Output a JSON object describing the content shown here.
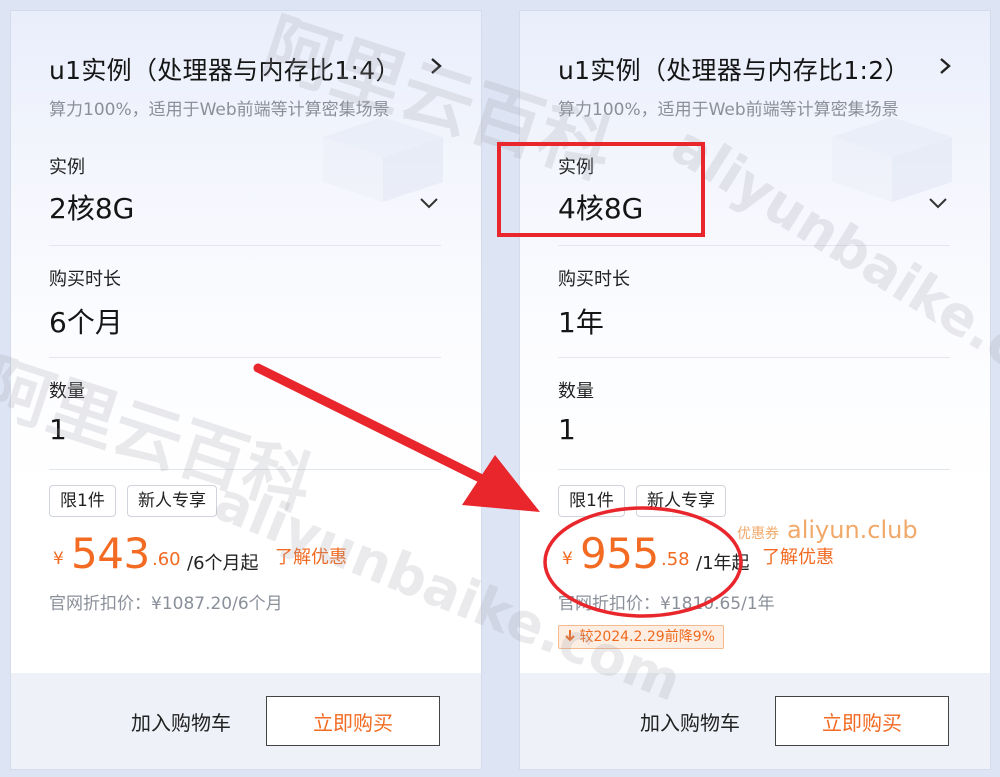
{
  "cards": [
    {
      "title": "u1实例（处理器与内存比1:4）",
      "subtitle": "算力100%，适用于Web前端等计算密集场景",
      "instance_label": "实例",
      "instance_value": "2核8G",
      "duration_label": "购买时长",
      "duration_value": "6个月",
      "quantity_label": "数量",
      "quantity_value": "1",
      "tags": [
        "限1件",
        "新人专享"
      ],
      "price_currency": "¥",
      "price_integer": "543",
      "price_decimal": ".60",
      "price_unit": "/6个月起",
      "learn_more": "了解优惠",
      "official_price": "官网折扣价：¥1087.20/6个月",
      "add_to_cart": "加入购物车",
      "buy_now": "立即购买"
    },
    {
      "title": "u1实例（处理器与内存比1:2）",
      "subtitle": "算力100%，适用于Web前端等计算密集场景",
      "instance_label": "实例",
      "instance_value": "4核8G",
      "duration_label": "购买时长",
      "duration_value": "1年",
      "quantity_label": "数量",
      "quantity_value": "1",
      "tags": [
        "限1件",
        "新人专享"
      ],
      "price_currency": "¥",
      "price_integer": "955",
      "price_decimal": ".58",
      "price_unit": "/1年起",
      "learn_more": "了解优惠",
      "official_price": "官网折扣价：¥1810.65/1年",
      "drop_badge": "较2024.2.29前降9%",
      "add_to_cart": "加入购物车",
      "buy_now": "立即购买"
    }
  ],
  "watermark": {
    "brand_small": "优惠券",
    "brand_large": "aliyun.club",
    "cn_text": "阿里云百科",
    "en_text": "aliyunbaike.com"
  },
  "colors": {
    "price_orange": "#f36a22",
    "annotation_red": "#e8262b",
    "page_background": "#dde4f4"
  },
  "icons": [
    "chevron-right-icon",
    "chevron-down-icon",
    "arrow-down-icon"
  ]
}
